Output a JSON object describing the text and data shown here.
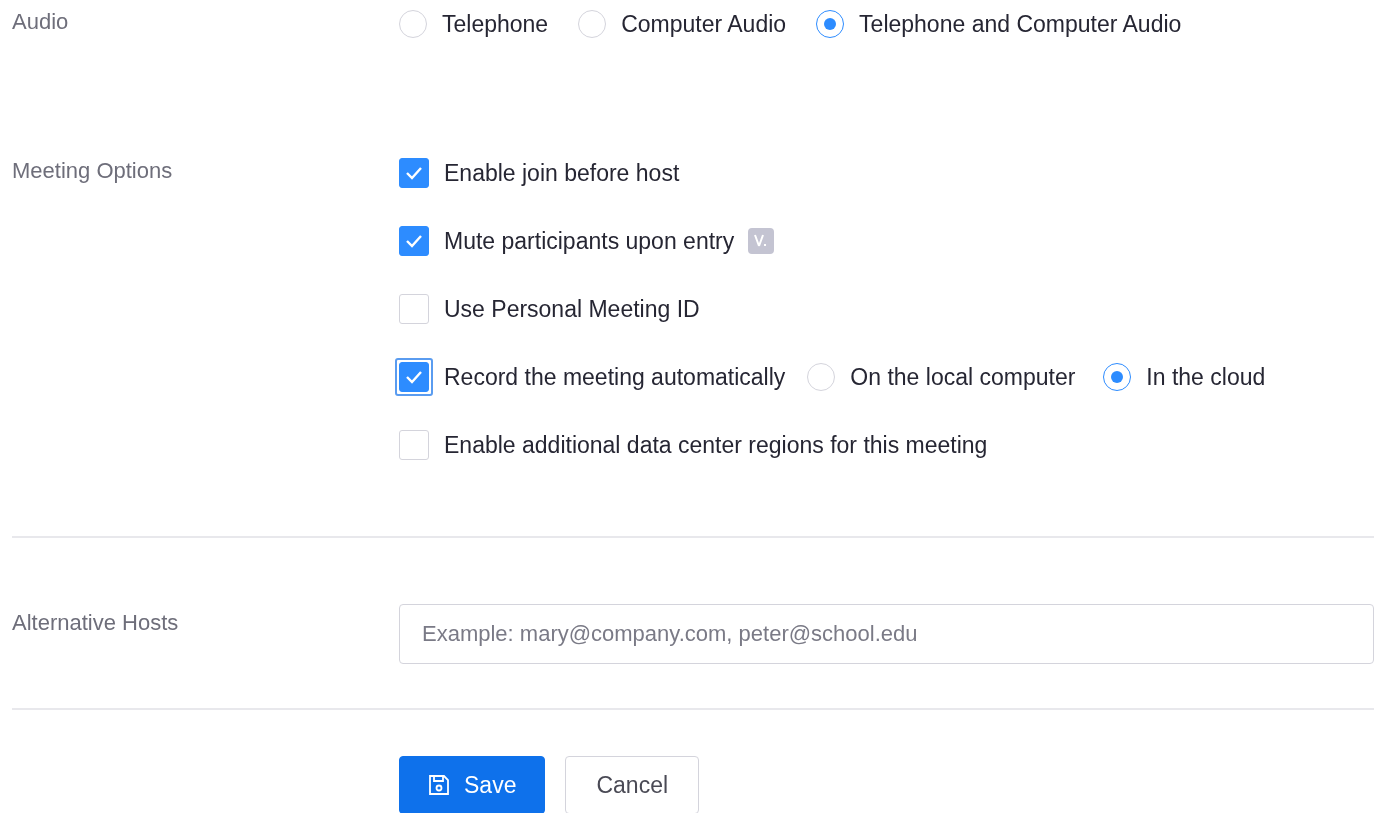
{
  "audio": {
    "label": "Audio",
    "options": [
      {
        "label": "Telephone",
        "selected": false
      },
      {
        "label": "Computer Audio",
        "selected": false
      },
      {
        "label": "Telephone and Computer Audio",
        "selected": true
      }
    ]
  },
  "meeting_options": {
    "label": "Meeting Options",
    "items": [
      {
        "label": "Enable join before host",
        "checked": true,
        "focused": false
      },
      {
        "label": "Mute participants upon entry",
        "checked": true,
        "focused": false,
        "info_badge": true
      },
      {
        "label": "Use Personal Meeting ID",
        "checked": false,
        "focused": false
      },
      {
        "label": "Record the meeting automatically",
        "checked": true,
        "focused": true,
        "choices": [
          {
            "label": "On the local computer",
            "selected": false
          },
          {
            "label": "In the cloud",
            "selected": true
          }
        ]
      },
      {
        "label": "Enable additional data center regions for this meeting",
        "checked": false,
        "focused": false
      }
    ]
  },
  "alternative_hosts": {
    "label": "Alternative Hosts",
    "placeholder": "Example: mary@company.com, peter@school.edu"
  },
  "buttons": [
    {
      "label": "Save",
      "kind": "primary"
    },
    {
      "label": "Cancel",
      "kind": "default"
    }
  ]
}
